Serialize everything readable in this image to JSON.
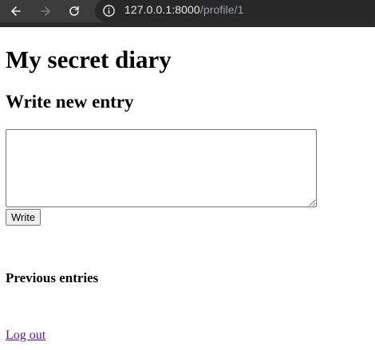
{
  "browser": {
    "url_host": "127.0.0.1:8000",
    "url_path": "/profile/1",
    "icons": {
      "back": "back-arrow-icon",
      "forward": "forward-arrow-icon",
      "reload": "reload-icon",
      "site_info": "info-icon"
    }
  },
  "page": {
    "title": "My secret diary",
    "new_entry_heading": "Write new entry",
    "entry_textarea_value": "",
    "write_button_label": "Write",
    "previous_entries_heading": "Previous entries",
    "logout_link": "Log out"
  },
  "colors": {
    "toolbar": "#3c3c3c",
    "omnibox": "#282828",
    "visited_link": "#551a8b"
  }
}
